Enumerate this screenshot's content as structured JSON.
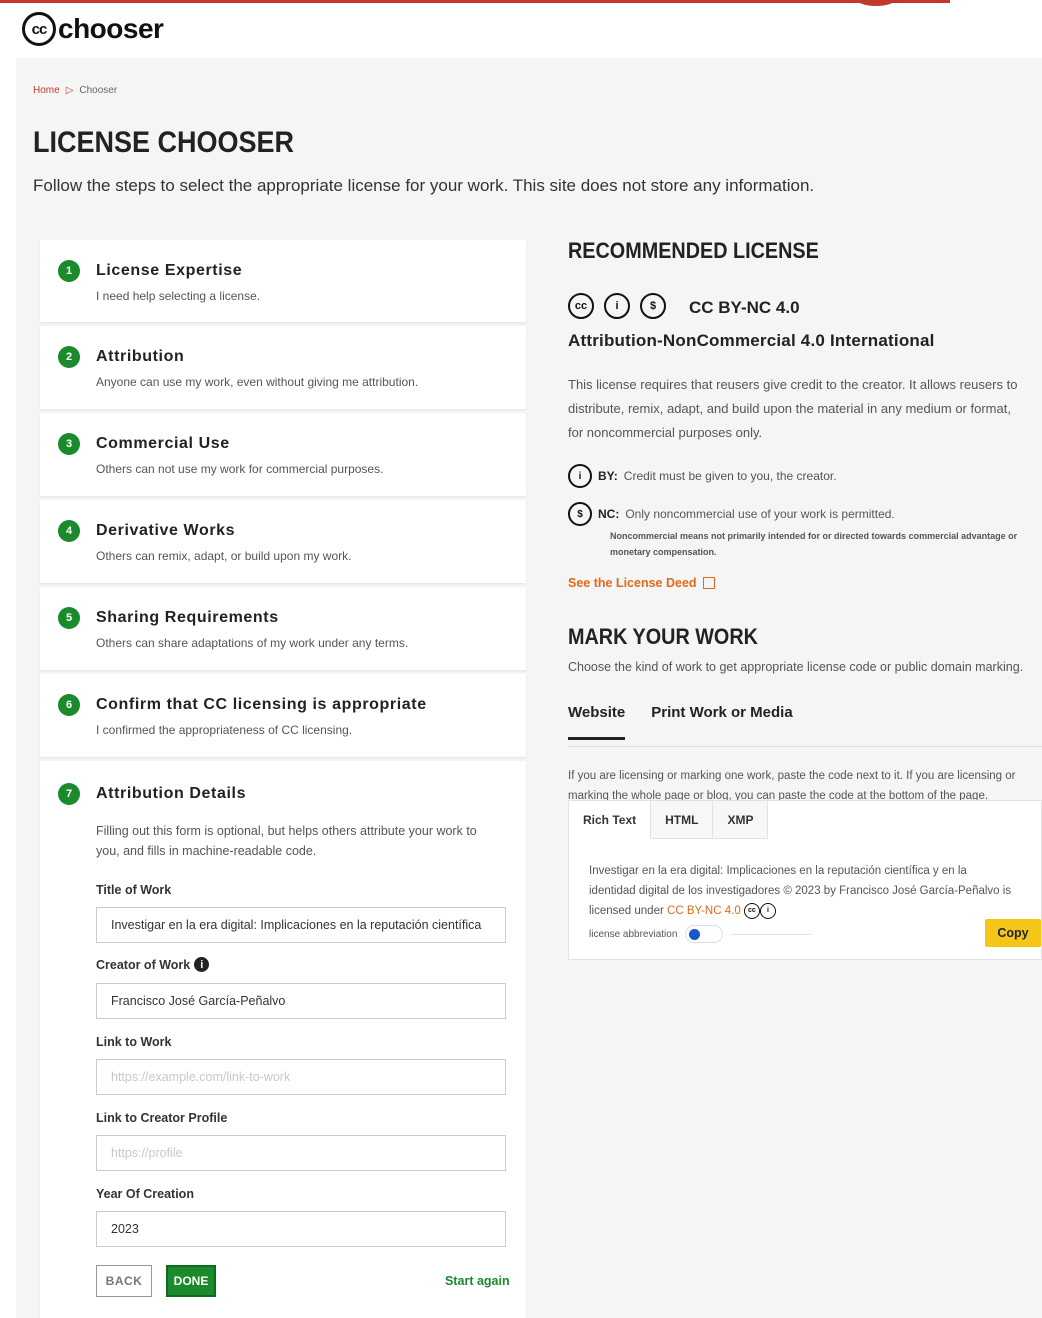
{
  "header": {
    "logo_text": "chooser",
    "logo_mark": "cc"
  },
  "breadcrumb": {
    "home": "Home",
    "separator": "▷",
    "current": "Chooser"
  },
  "page": {
    "title": "LICENSE CHOOSER",
    "subtitle": "Follow the steps to select the appropriate license for your work. This site does not store any information."
  },
  "steps": [
    {
      "num": "1",
      "title": "License Expertise",
      "desc": "I need help selecting a license."
    },
    {
      "num": "2",
      "title": "Attribution",
      "desc": "Anyone can use my work, even without giving me attribution."
    },
    {
      "num": "3",
      "title": "Commercial Use",
      "desc": "Others can not use my work for commercial purposes."
    },
    {
      "num": "4",
      "title": "Derivative Works",
      "desc": "Others can remix, adapt, or build upon my work."
    },
    {
      "num": "5",
      "title": "Sharing Requirements",
      "desc": "Others can share adaptations of my work under any terms."
    },
    {
      "num": "6",
      "title": "Confirm that CC licensing is appropriate",
      "desc": "I confirmed the appropriateness of CC licensing."
    }
  ],
  "attribution_details": {
    "num": "7",
    "title": "Attribution Details",
    "intro": "Filling out this form is optional, but helps others attribute your work to you, and fills in machine-readable code.",
    "title_label": "Title of Work",
    "title_value": "Investigar en la era digital: Implicaciones en la reputación científica",
    "creator_label": "Creator of Work",
    "creator_value": "Francisco José García-Peñalvo",
    "link_label": "Link to Work",
    "link_placeholder": "https://example.com/link-to-work",
    "profile_label": "Link to Creator Profile",
    "profile_placeholder": "https://profile",
    "year_label": "Year Of Creation",
    "year_value": "2023",
    "back": "BACK",
    "done": "DONE",
    "start_again": "Start again"
  },
  "recommended": {
    "heading": "RECOMMENDED LICENSE",
    "short": "CC BY-NC 4.0",
    "full": "Attribution-NonCommercial 4.0 International",
    "desc_line1": "This license requires that reusers give credit to the creator. It allows reusers to",
    "desc_line2": "distribute, remix, adapt, and build upon the material in any medium or format,",
    "desc_line3": "for noncommercial purposes only.",
    "by_label": "BY:",
    "by_text": "Credit must be given to you, the creator.",
    "nc_label": "NC:",
    "nc_text": "Only noncommercial use of your work is permitted.",
    "nc_note_1": "Noncommercial means not primarily intended for or directed towards commercial advantage or",
    "nc_note_2": "monetary compensation.",
    "deed_link": "See the License Deed"
  },
  "mark": {
    "heading": "MARK YOUR WORK",
    "desc": "Choose the kind of work to get appropriate license code or public domain marking.",
    "tabs": [
      "Website",
      "Print Work or Media"
    ],
    "embed_line1": "If you are licensing or marking one work, paste the code next to it. If you are licensing or",
    "embed_line2": "marking the whole page or blog, you can paste the code at the bottom of the page.",
    "code_tabs": [
      "Rich Text",
      "HTML",
      "XMP"
    ],
    "code_text_1": "Investigar en la era digital: Implicaciones en la reputación científica y en la",
    "code_text_2": "identidad digital de los investigadores © 2023 by Francisco José García-Peñalvo is",
    "code_text_3": "licensed under",
    "code_link": "CC BY-NC 4.0",
    "toggle_label": "license abbreviation",
    "copy": "Copy"
  },
  "colors": {
    "accent_green": "#1a8a2c",
    "accent_orange": "#e06a1b",
    "brand_red": "#c0392b",
    "copy_yellow": "#f5c518"
  }
}
